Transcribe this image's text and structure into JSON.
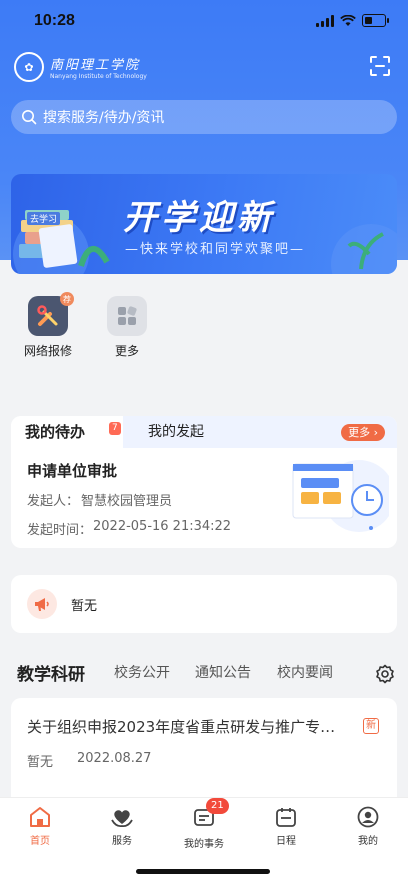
{
  "status": {
    "time": "10:28"
  },
  "header": {
    "logo_cn": "南阳理工学院",
    "logo_en": "Nanyang Institute of Technology",
    "search_placeholder": "搜索服务/待办/资讯"
  },
  "banner": {
    "title": "开学迎新",
    "subtitle": "—快来学校和同学欢聚吧—",
    "book_label": "去学习"
  },
  "quick_actions": [
    {
      "label": "网络报修",
      "badge": "荐",
      "icon": "tools-icon"
    },
    {
      "label": "更多",
      "icon": "grid-icon"
    }
  ],
  "todo": {
    "tab_active": "我的待办",
    "tab_count": "7",
    "tab_other": "我的发起",
    "more": "更多",
    "item_title": "申请单位审批",
    "initiator_label": "发起人：",
    "initiator": "智慧校园管理员",
    "time_label": "发起时间：",
    "time": "2022-05-16 21:34:22"
  },
  "notice": {
    "text": "暂无"
  },
  "news": {
    "tabs": [
      "教学科研",
      "校务公开",
      "通知公告",
      "校内要闻"
    ],
    "item_title": "关于组织申报2023年度省重点研发与推广专…",
    "item_badge": "新",
    "item_source": "暂无",
    "item_date": "2022.08.27"
  },
  "nav": [
    {
      "label": "首页",
      "icon": "home-icon"
    },
    {
      "label": "服务",
      "icon": "service-icon"
    },
    {
      "label": "我的事务",
      "icon": "affairs-icon",
      "badge": "21"
    },
    {
      "label": "日程",
      "icon": "calendar-icon"
    },
    {
      "label": "我的",
      "icon": "profile-icon"
    }
  ],
  "colors": {
    "primary": "#3d7bf6",
    "accent": "#f06b45"
  }
}
